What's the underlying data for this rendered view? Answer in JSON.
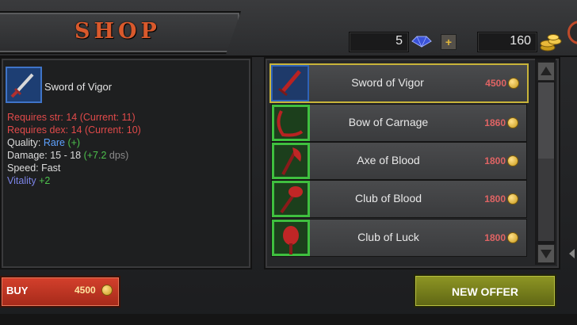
{
  "header": {
    "title": "SHOP",
    "gems": "5",
    "gold": "160",
    "add_label": "+"
  },
  "detail": {
    "name": "Sword of Vigor",
    "stats": [
      {
        "text": "Requires str: 14 (Current: 11)",
        "color": "red"
      },
      {
        "text": "Requires dex: 14 (Current: 10)",
        "color": "red"
      }
    ],
    "quality_label": "Quality: ",
    "quality_value": "Rare",
    "quality_plus": "(+)",
    "damage_label": "Damage: 15 - 18 ",
    "damage_bonus": "(+7.2",
    "damage_unit": " dps)",
    "speed": "Speed: Fast",
    "vitality_label": "Vitality ",
    "vitality_value": "+2"
  },
  "items": [
    {
      "name": "Sword of Vigor",
      "price": "4500",
      "icon": "sword-icon",
      "selected": true,
      "frame": "blue"
    },
    {
      "name": "Bow of Carnage",
      "price": "1860",
      "icon": "bow-icon",
      "selected": false,
      "frame": "green"
    },
    {
      "name": "Axe of Blood",
      "price": "1800",
      "icon": "axe-icon",
      "selected": false,
      "frame": "green"
    },
    {
      "name": "Club of Blood",
      "price": "1800",
      "icon": "club-icon",
      "selected": false,
      "frame": "green"
    },
    {
      "name": "Club of Luck",
      "price": "1800",
      "icon": "club-icon",
      "selected": false,
      "frame": "green"
    }
  ],
  "buy": {
    "label": "BUY",
    "price": "4500"
  },
  "new_offer": {
    "label": "NEW OFFER"
  },
  "colors": {
    "title": "#d9592c",
    "selected_border": "#c8b43a",
    "price": "#e06464",
    "buy": "#c0392b",
    "new_offer": "#7d851c"
  }
}
